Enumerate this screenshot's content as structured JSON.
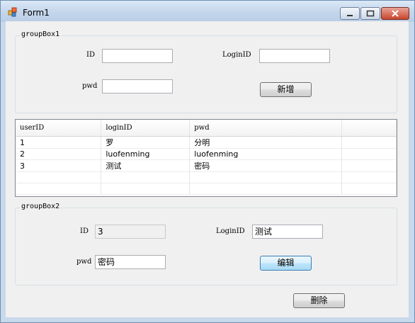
{
  "window": {
    "title": "Form1"
  },
  "group1": {
    "legend": "groupBox1",
    "id_label": "ID",
    "id_value": "",
    "loginid_label": "LoginID",
    "loginid_value": "",
    "pwd_label": "pwd",
    "pwd_value": "",
    "add_button": "新增"
  },
  "grid": {
    "headers": [
      "userID",
      "loginID",
      "pwd",
      ""
    ],
    "rows": [
      [
        "1",
        "罗",
        "分明",
        ""
      ],
      [
        "2",
        "luofenming",
        "luofenming",
        ""
      ],
      [
        "3",
        "测试",
        "密码",
        ""
      ],
      [
        "",
        "",
        "",
        ""
      ],
      [
        "",
        "",
        "",
        ""
      ]
    ]
  },
  "group2": {
    "legend": "groupBox2",
    "id_label": "ID",
    "id_value": "3",
    "loginid_label": "LoginID",
    "loginid_value": "测试",
    "pwd_label": "pwd",
    "pwd_value": "密码",
    "edit_button": "编辑"
  },
  "delete_button": "删除"
}
